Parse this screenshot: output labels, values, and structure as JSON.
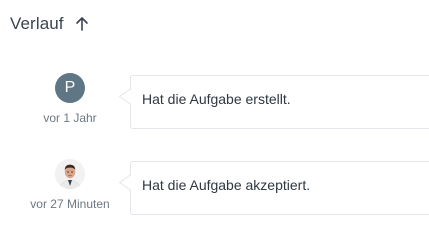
{
  "history": {
    "title": "Verlauf",
    "sort_icon": "arrow-up-icon",
    "entries": [
      {
        "avatar_type": "initial",
        "avatar_initial": "P",
        "avatar_color": "#5f7684",
        "time": "vor 1 Jahr",
        "text": "Hat die Aufgabe erstellt."
      },
      {
        "avatar_type": "photo",
        "avatar_icon": "user-photo-icon",
        "time": "vor 27 Minuten",
        "text": "Hat die Aufgabe akzeptiert."
      }
    ]
  },
  "colors": {
    "text_primary": "#2f3742",
    "text_muted": "#6d7884",
    "border": "#e3e6ea"
  }
}
